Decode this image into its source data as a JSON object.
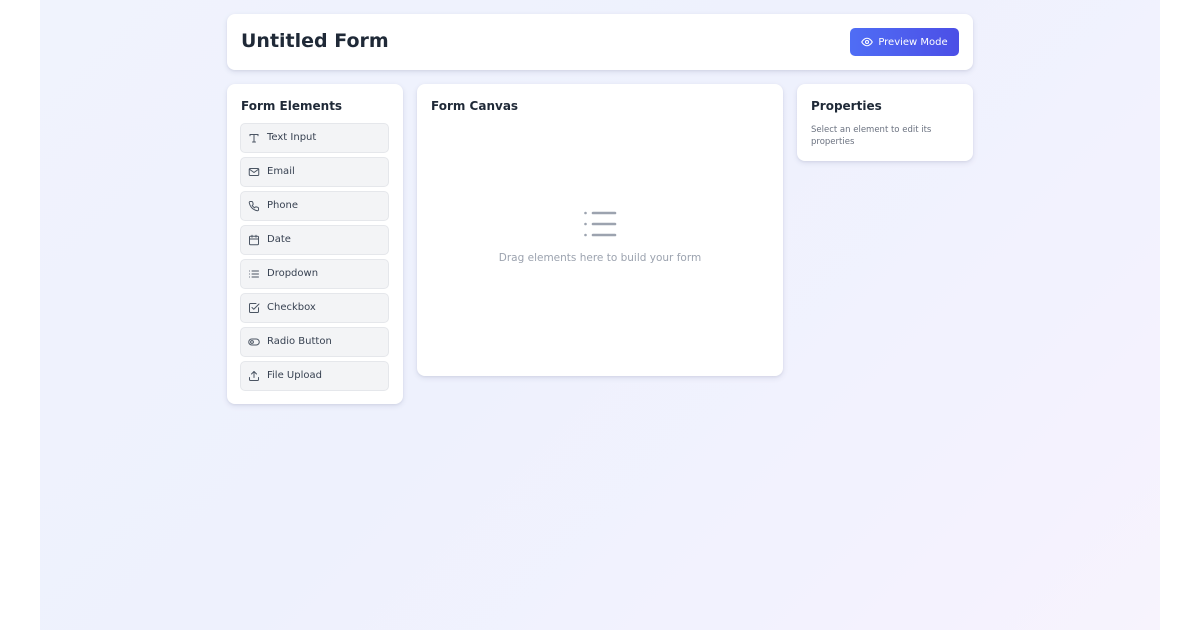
{
  "header": {
    "title": "Untitled Form",
    "preview_button": {
      "label": "Preview Mode",
      "icon": "eye-icon"
    }
  },
  "elements_panel": {
    "title": "Form Elements",
    "items": [
      {
        "label": "Text Input",
        "icon": "text-type-icon"
      },
      {
        "label": "Email",
        "icon": "mail-icon"
      },
      {
        "label": "Phone",
        "icon": "phone-icon"
      },
      {
        "label": "Date",
        "icon": "calendar-icon"
      },
      {
        "label": "Dropdown",
        "icon": "list-icon"
      },
      {
        "label": "Checkbox",
        "icon": "checkbox-icon"
      },
      {
        "label": "Radio Button",
        "icon": "toggle-icon"
      },
      {
        "label": "File Upload",
        "icon": "upload-icon"
      }
    ]
  },
  "canvas": {
    "title": "Form Canvas",
    "empty_icon": "list-icon",
    "empty_text": "Drag elements here to build your form"
  },
  "properties": {
    "title": "Properties",
    "empty_text": "Select an element to edit its properties"
  },
  "colors": {
    "accent": "#4f6df5",
    "accent_end": "#4c4fe6",
    "background": "#eef1fd",
    "muted_text": "#9ca3af"
  }
}
